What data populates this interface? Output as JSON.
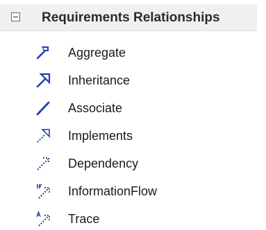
{
  "header": {
    "title": "Requirements Relationships",
    "collapse_icon": "collapse-minus-icon"
  },
  "items": [
    {
      "label": "Aggregate",
      "icon": "aggregate-icon"
    },
    {
      "label": "Inheritance",
      "icon": "inheritance-icon"
    },
    {
      "label": "Associate",
      "icon": "associate-icon"
    },
    {
      "label": "Implements",
      "icon": "implements-icon"
    },
    {
      "label": "Dependency",
      "icon": "dependency-icon"
    },
    {
      "label": "InformationFlow",
      "icon": "information-flow-icon"
    },
    {
      "label": "Trace",
      "icon": "trace-icon"
    }
  ],
  "colors": {
    "icon_blue": "#1f3fa8",
    "header_bg": "#f0f0f0"
  }
}
